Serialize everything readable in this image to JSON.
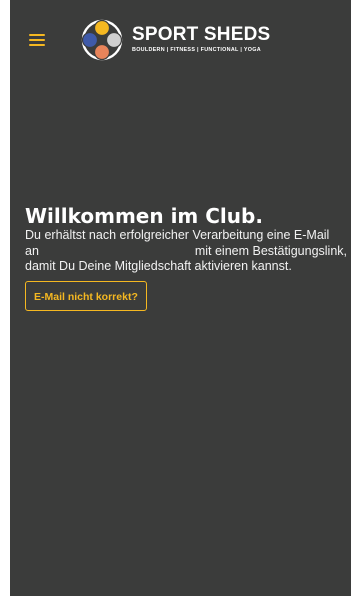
{
  "header": {
    "brand_name": "SPORT SHEDS",
    "brand_tagline": "BOULDERN | FITNESS | FUNCTIONAL | YOGA",
    "menu_icon": "hamburger-menu-icon",
    "logo_icon": "four-circle-logo-icon"
  },
  "main": {
    "title": "Willkommen im Club.",
    "text_line1": "Du erhältst nach erfolgreicher Verarbeitung eine E-Mail",
    "text_line2_start": "an",
    "text_line2_end": "mit einem Bestätigungslink,",
    "text_line3": "damit Du Deine Mitgliedschaft aktivieren kannst.",
    "email_button_label": "E-Mail nicht korrekt?"
  },
  "colors": {
    "background": "#3b3c3b",
    "accent": "#f5b821",
    "text": "#ffffff",
    "logo_yellow": "#f5b821",
    "logo_blue": "#3f5aa8",
    "logo_orange": "#e8845a",
    "logo_grey": "#cfcfcf"
  }
}
